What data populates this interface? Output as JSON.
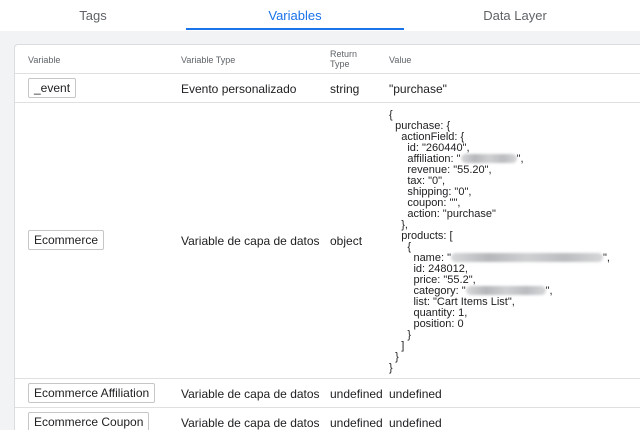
{
  "tabs": [
    {
      "label": "Tags"
    },
    {
      "label": "Variables"
    },
    {
      "label": "Data Layer"
    }
  ],
  "active_tab": "Variables",
  "table": {
    "headers": {
      "variable": "Variable",
      "variable_type": "Variable Type",
      "return_type_line1": "Return",
      "return_type_line2": "Type",
      "value": "Value"
    },
    "rows": [
      {
        "variable": "_event",
        "type": "Evento personalizado",
        "return_type": "string",
        "value": "\"purchase\""
      },
      {
        "variable": "Ecommerce",
        "type": "Variable de capa de datos",
        "return_type": "object"
      },
      {
        "variable": "Ecommerce Affiliation",
        "type": "Variable de capa de datos",
        "return_type": "undefined",
        "value": "undefined"
      },
      {
        "variable": "Ecommerce Coupon",
        "type": "Variable de capa de datos",
        "return_type": "undefined",
        "value": "undefined"
      }
    ],
    "ecommerce_value": {
      "l1": "{",
      "l2": "  purchase: {",
      "l3": "    actionField: {",
      "l4": "      id: \"260440\",",
      "l5a": "      affiliation: \"",
      "l5b": "\",",
      "l6": "      revenue: \"55.20\",",
      "l7": "      tax: \"0\",",
      "l8": "      shipping: \"0\",",
      "l9": "      coupon: \"\",",
      "l10": "      action: \"purchase\"",
      "l11": "    },",
      "l12": "    products: [",
      "l13": "      {",
      "l14a": "        name: \"",
      "l14b": "\",",
      "l15": "        id: 248012,",
      "l16": "        price: \"55.2\",",
      "l17a": "        category: \"",
      "l17b": "\",",
      "l18": "        list: \"Cart Items List\",",
      "l19": "        quantity: 1,",
      "l20": "        position: 0",
      "l21": "      }",
      "l22": "    ]",
      "l23": "  }",
      "l24": "}"
    }
  }
}
